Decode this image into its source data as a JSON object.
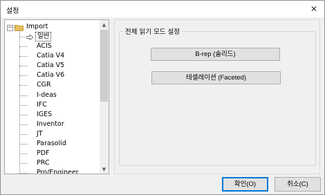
{
  "window": {
    "title": "설정",
    "close_glyph": "✕"
  },
  "tree": {
    "root": {
      "label": "Import",
      "expander": "−"
    },
    "selected": {
      "label": "일반"
    },
    "items": [
      {
        "label": "ACIS"
      },
      {
        "label": "Catia V4"
      },
      {
        "label": "Catia V5"
      },
      {
        "label": "Catia V6"
      },
      {
        "label": "CGR"
      },
      {
        "label": "I-deas"
      },
      {
        "label": "IFC"
      },
      {
        "label": "IGES"
      },
      {
        "label": "Inventor"
      },
      {
        "label": "JT"
      },
      {
        "label": "Parasolid"
      },
      {
        "label": "PDF"
      },
      {
        "label": "PRC"
      },
      {
        "label": "Pro/Engineer"
      }
    ],
    "scroll_up": "▲",
    "scroll_down": "▼"
  },
  "group": {
    "title": "전체 읽기 모드 설정",
    "brep_label": "B-rep (솔리드)",
    "faceted_label": "테셀레이션 (Faceted)"
  },
  "footer": {
    "ok_label": "확인(O)",
    "cancel_label": "취소(C)"
  },
  "colors": {
    "folder": "#e8c15a",
    "accent": "#0078d7",
    "button_face": "#e1e1e1"
  }
}
